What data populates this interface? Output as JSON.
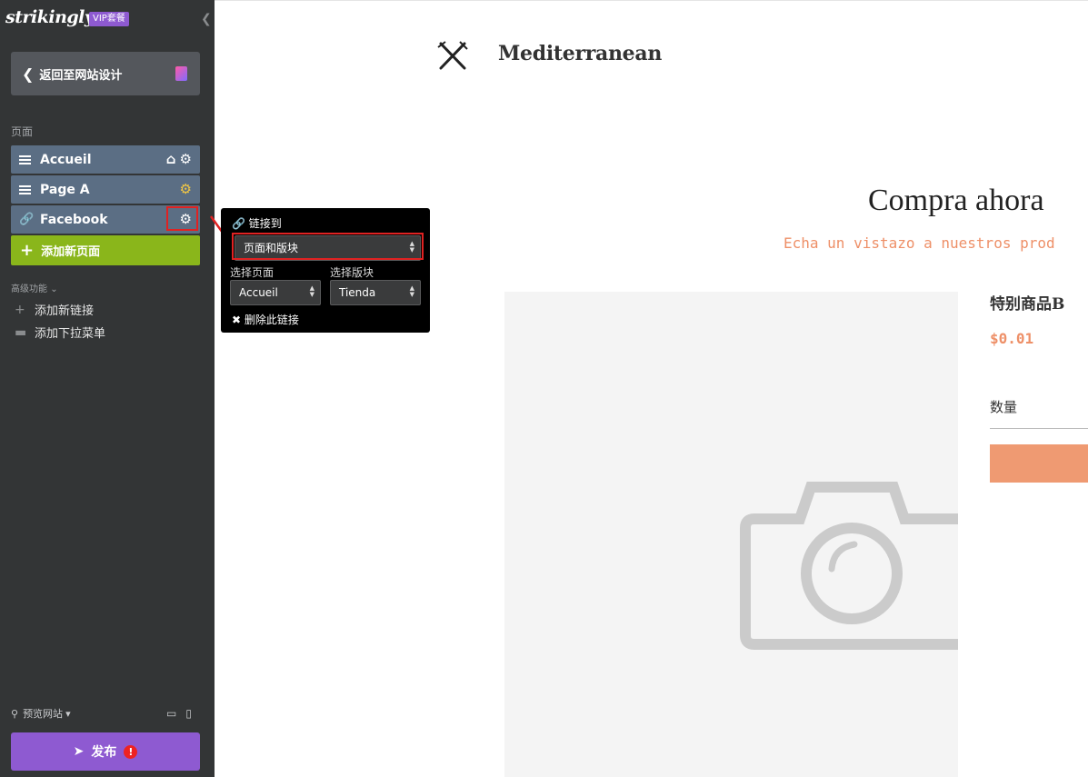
{
  "sidebar": {
    "brand": "strikingly",
    "vip_badge": "VIP套餐",
    "back_button": "返回至网站设计",
    "pages_label": "页面",
    "pages": [
      {
        "label": "Accueil",
        "icon": "menu-handle-icon"
      },
      {
        "label": "Page A",
        "icon": "menu-handle-icon"
      },
      {
        "label": "Facebook",
        "icon": "link-icon"
      }
    ],
    "add_page": "添加新页面",
    "advanced_label": "高级功能",
    "add_link": "添加新链接",
    "add_dropdown": "添加下拉菜单",
    "preview": "预览网站",
    "publish": "发布",
    "publish_alert": "!"
  },
  "popover": {
    "title": "链接到",
    "link_type": "页面和版块",
    "page_label": "选择页面",
    "page_value": "Accueil",
    "section_label": "选择版块",
    "section_value": "Tienda",
    "delete": "删除此链接"
  },
  "site": {
    "name": "Mediterranean",
    "shop_title": "Compra ahora",
    "shop_subtitle": "Echa un vistazo a nuestros prod",
    "product_name": "特别商品B",
    "price": "$0.01",
    "quantity_label": "数量"
  },
  "colors": {
    "sidebar_bg": "#333536",
    "page_item": "#5b6e84",
    "add_page": "#8ab61b",
    "publish": "#8e5ad1",
    "accent": "#ee9068",
    "highlight": "#e02222"
  }
}
